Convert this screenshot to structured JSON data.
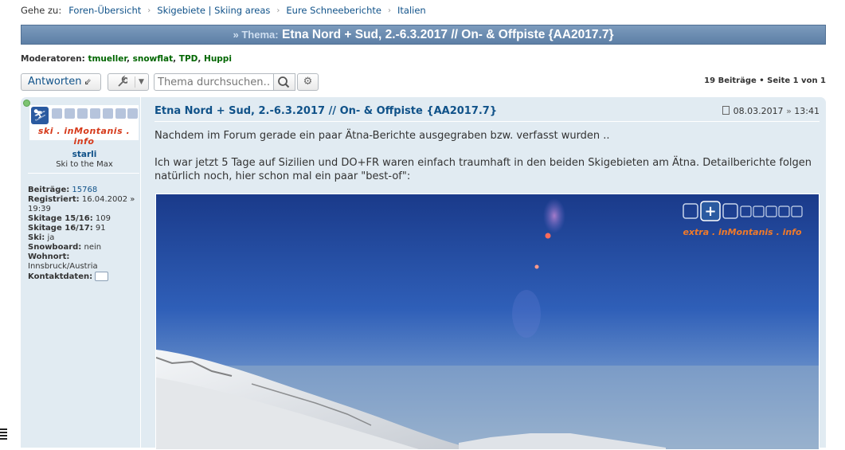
{
  "breadcrumb": {
    "prefix": "Gehe zu:",
    "items": [
      "Foren-Übersicht",
      "Skigebiete | Skiing areas",
      "Eure Schneeberichte",
      "Italien"
    ]
  },
  "topic": {
    "prefix": "» Thema:",
    "title": "Etna Nord + Sud, 2.-6.3.2017 // On- & Offpiste {AA2017.7}"
  },
  "moderators": {
    "label": "Moderatoren:",
    "names": [
      "tmueller",
      "snowflat",
      "TPD",
      "Huppi"
    ]
  },
  "toolbar": {
    "reply_label": "Antworten",
    "search_placeholder": "Thema durchsuchen…",
    "icons": [
      "reply-arrow-icon",
      "wrench-icon",
      "caret-down-icon",
      "search-icon",
      "gear-icon"
    ]
  },
  "pagination": {
    "text": "19 Beiträge • Seite 1 von 1"
  },
  "post": {
    "author": {
      "username": "starli",
      "rank": "Ski to the Max",
      "avatar_text": "ski . inMontanis . info",
      "online_color": "#7cc472",
      "fields": [
        {
          "key": "Beiträge:",
          "value": "15768",
          "link": true
        },
        {
          "key": "Registriert:",
          "value": "16.04.2002 » 19:39",
          "link": false
        },
        {
          "key": "Skitage 15/16:",
          "value": "109",
          "link": false
        },
        {
          "key": "Skitage 16/17:",
          "value": "91",
          "link": false
        },
        {
          "key": "Ski:",
          "value": "ja",
          "link": false
        },
        {
          "key": "Snowboard:",
          "value": "nein",
          "link": false
        },
        {
          "key": "Wohnort:",
          "value": "Innsbruck/Austria",
          "link": false
        },
        {
          "key": "Kontaktdaten:",
          "value": "",
          "link": false
        }
      ]
    },
    "title": "Etna Nord + Sud, 2.-6.3.2017 // On- & Offpiste {AA2017.7}",
    "date": "08.03.2017",
    "time": "13:41",
    "paragraphs": [
      "Nachdem im Forum gerade ein paar Ätna-Berichte ausgegraben bzw. verfasst wurden ..",
      "Ich war jetzt 5 Tage auf Sizilien und DO+FR waren einfach traumhaft in den beiden Skigebieten am Ätna. Detailberichte folgen natürlich noch, hier schon mal ein paar \"best-of\":"
    ],
    "photo_watermark": "extra . inMontanis . info"
  },
  "colors": {
    "link": "#105289",
    "moderator": "#006600",
    "topic_bar": "#5d7fa6",
    "post_bg": "#e1ebf2"
  }
}
